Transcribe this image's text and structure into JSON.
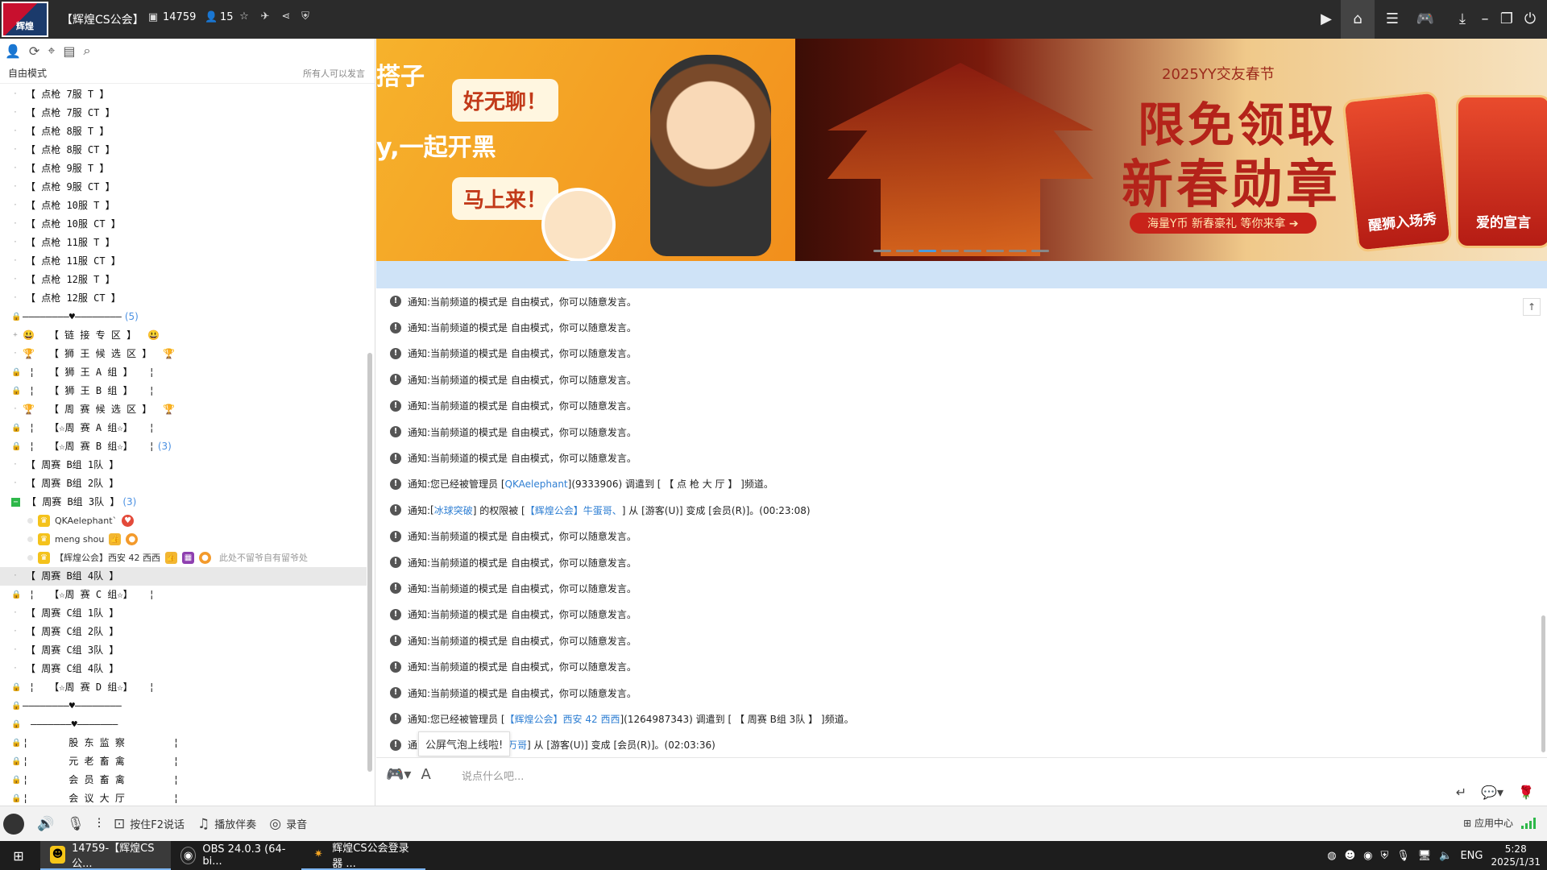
{
  "titlebar": {
    "channel_name": "【辉煌CS公会】",
    "channel_id": "14759",
    "online_count": "15",
    "logo_text": "辉煌"
  },
  "left": {
    "mode": "自由模式",
    "permission": "所有人可以发言",
    "channels_top": [
      "【 点枪 7服  T   】",
      "【 点枪 7服  CT  】",
      "【 点枪 8服  T   】",
      "【 点枪 8服  CT  】",
      "【 点枪 9服  T   】",
      "【 点枪 9服  CT  】",
      "【 点枪 10服  T  】",
      "【 点枪 10服  CT 】",
      "【 点枪 11服  T  】",
      "【 点枪 11服  CT 】",
      "【 点枪 12服   T 】",
      "【 点枪 12服  CT 】"
    ],
    "divider1": "————————♥————————",
    "divider1_count": "(5)",
    "link_zone": "【 链  接  专  区 】",
    "lion_candidates": "【 狮 王 候 选 区 】",
    "lion_a": "【 狮 王 A 组 】",
    "lion_b": "【 狮 王 B 组 】",
    "weekly_candidates": "【 周 赛 候 选 区 】",
    "weekly_a": "【☆周 赛 A 组☆】",
    "weekly_b": "【☆周 赛 B 组☆】",
    "weekly_b_count": "(3)",
    "b_teams": [
      "【 周赛 B组 1队 】",
      "【 周赛 B组 2队 】",
      "【 周赛 B组 3队 】"
    ],
    "b3_count": "(3)",
    "users": [
      {
        "name": "QKAelephant`"
      },
      {
        "name": "meng shou"
      },
      {
        "name": "【辉煌公会】西安 42 西西",
        "hint": "此处不留爷自有留爷处"
      }
    ],
    "b4_team": "【 周赛 B组 4队 】",
    "weekly_c": "【☆周 赛 C 组☆】",
    "c_teams": [
      "【 周赛 C组 1队 】",
      "【 周赛 C组 2队 】",
      "【 周赛 C组 3队 】",
      "【 周赛 C组 4队 】"
    ],
    "weekly_d": "【☆周 赛 D 组☆】",
    "divider2": "————————♥————————",
    "divider3": "———————♥———————",
    "misc": [
      "股 东 监 察",
      "元 老 畜 禽",
      "会 员 畜 禽",
      "会 议 大 厅"
    ]
  },
  "banner": {
    "left_partial": "搭子",
    "pill1": "好无聊！",
    "pill2": "y,一起开黑",
    "pill3": "马上来！",
    "festival": "2025YY交友春节",
    "headline1": "限免领取",
    "headline2": "新春勋章",
    "subline": "海量Y币 新春豪礼 等你来拿 ➔",
    "card1": "醒狮入场秀",
    "card2": "爱的宣言"
  },
  "messages": {
    "notice_label": "通知:",
    "free_mode": "当前频道的模式是 自由模式，你可以随意发言。",
    "moved1_prefix": "您已经被管理员 [",
    "moved1_admin": "QKAelephant",
    "moved1_suffix": "](9333906) 调遣到 [  【 点 枪 大 厅 】 ]频道。",
    "perm_prefix": "[",
    "perm_user": "冰球突破",
    "perm_mid": "] 的权限被 [",
    "perm_admin": "【辉煌公会】牛蛋哥、",
    "perm_suffix": "] 从 [游客(U)] 变成 [会员(R)]。(00:23:08)",
    "moved2_prefix": "您已经被管理员 [",
    "moved2_admin": "【辉煌公会】西安 42 西西",
    "moved2_suffix": "](1264987343) 调遣到 [ 【 周赛 B组 3队 】 ]频道。",
    "last_prefix": "通",
    "last_admin": "万哥",
    "last_suffix": "] 从 [游客(U)] 变成 [会员(R)]。(02:03:36)",
    "tooltip": "公屏气泡上线啦!"
  },
  "input": {
    "placeholder": "说点什么吧..."
  },
  "bottombar": {
    "speak_mode": "按住F2说话",
    "music": "播放伴奏",
    "record": "录音",
    "app_center": "应用中心"
  },
  "taskbar": {
    "tasks": [
      "14759-【辉煌CS公...",
      "OBS 24.0.3 (64-bi...",
      "辉煌CS公会登录器 ..."
    ],
    "lang": "ENG",
    "time": "5:28",
    "date": "2025/1/31"
  }
}
